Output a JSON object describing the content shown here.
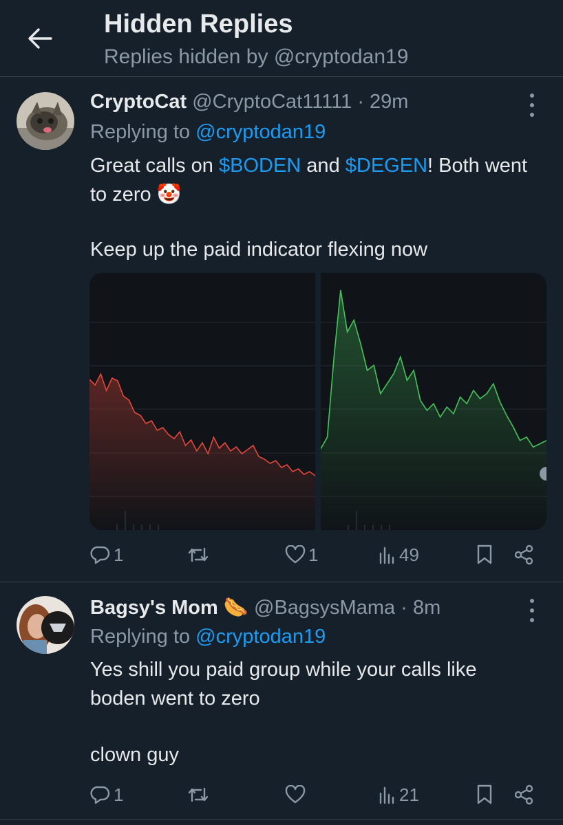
{
  "header": {
    "title": "Hidden Replies",
    "subtitle": "Replies hidden by @cryptodan19"
  },
  "tweets": [
    {
      "name": "CryptoCat",
      "handle": "@CryptoCat11111",
      "dot": "·",
      "time": "29m",
      "replying_prefix": "Replying to ",
      "replying_to": "@cryptodan19",
      "text_parts": [
        "Great calls on ",
        "$BODEN",
        " and ",
        "$DEGEN",
        "! Both went to zero ",
        "🤡"
      ],
      "text_line2": "Keep up the paid indicator flexing now",
      "replies": "1",
      "likes": "1",
      "views": "49"
    },
    {
      "name": "Bagsy's Mom",
      "name_emoji": "🌭",
      "handle": "@BagsysMama",
      "dot": "·",
      "time": "8m",
      "replying_prefix": "Replying to ",
      "replying_to": "@cryptodan19",
      "text_line1": "Yes shill you paid group while your calls like boden went to zero",
      "text_line2": "clown guy",
      "replies": "1",
      "views": "21"
    }
  ],
  "chart_data": [
    {
      "type": "area",
      "series": [
        {
          "values": [
            70,
            66,
            74,
            62,
            71,
            69,
            58,
            55,
            46,
            44,
            38,
            40,
            33,
            35,
            30,
            27,
            32,
            22,
            26,
            18,
            24,
            16,
            28,
            20,
            24,
            18,
            21,
            16,
            19,
            22,
            14,
            12,
            9,
            11,
            6,
            8,
            3,
            5,
            1,
            3,
            0
          ]
        }
      ],
      "color": "#e5473b"
    },
    {
      "type": "area",
      "series": [
        {
          "values": [
            5,
            12,
            60,
            100,
            75,
            82,
            68,
            52,
            55,
            38,
            44,
            50,
            60,
            46,
            52,
            34,
            28,
            32,
            24,
            30,
            26,
            36,
            32,
            40,
            35,
            38,
            44,
            33,
            25,
            18,
            10,
            12,
            6,
            8,
            10
          ]
        }
      ],
      "color": "#44c45a"
    }
  ],
  "colors": {
    "background": "#15202b",
    "text": "#e7e9ea",
    "secondary": "#8b98a5",
    "link": "#1d9bf0",
    "divider": "#38444d"
  },
  "icons": [
    "back-arrow-icon",
    "more-icon",
    "reply-icon",
    "retweet-icon",
    "like-icon",
    "views-icon",
    "bookmark-icon",
    "share-icon"
  ]
}
